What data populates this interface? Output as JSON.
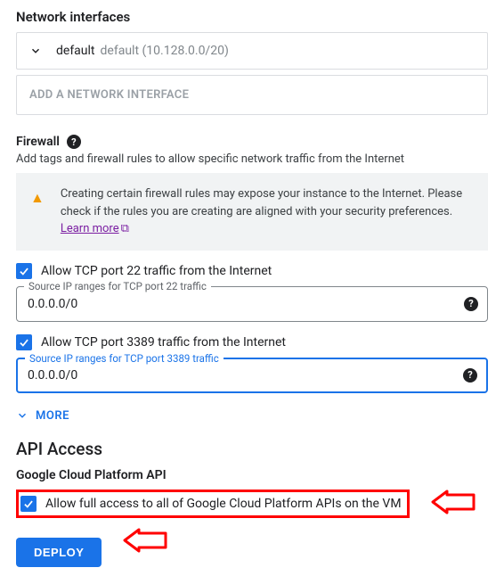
{
  "network": {
    "title": "Network interfaces",
    "default_name": "default",
    "default_detail": "default (10.128.0.0/20)",
    "add_label": "ADD A NETWORK INTERFACE"
  },
  "firewall": {
    "label": "Firewall",
    "subtext": "Add tags and firewall rules to allow specific network traffic from the Internet",
    "warn_text": "Creating certain firewall rules may expose your instance to the Internet. Please check if the rules you are creating are aligned with your security preferences. ",
    "learn_more": "Learn more",
    "cb22": "Allow TCP port 22 traffic from the Internet",
    "field22_label": "Source IP ranges for TCP port 22 traffic",
    "field22_value": "0.0.0.0/0",
    "cb3389": "Allow TCP port 3389 traffic from the Internet",
    "field3389_label": "Source IP ranges for TCP port 3389 traffic",
    "field3389_value": "0.0.0.0/0",
    "more": "MORE"
  },
  "api": {
    "title": "API Access",
    "subhead": "Google Cloud Platform API",
    "cb_label": "Allow full access to all of Google Cloud Platform APIs on the VM"
  },
  "deploy": "DEPLOY"
}
